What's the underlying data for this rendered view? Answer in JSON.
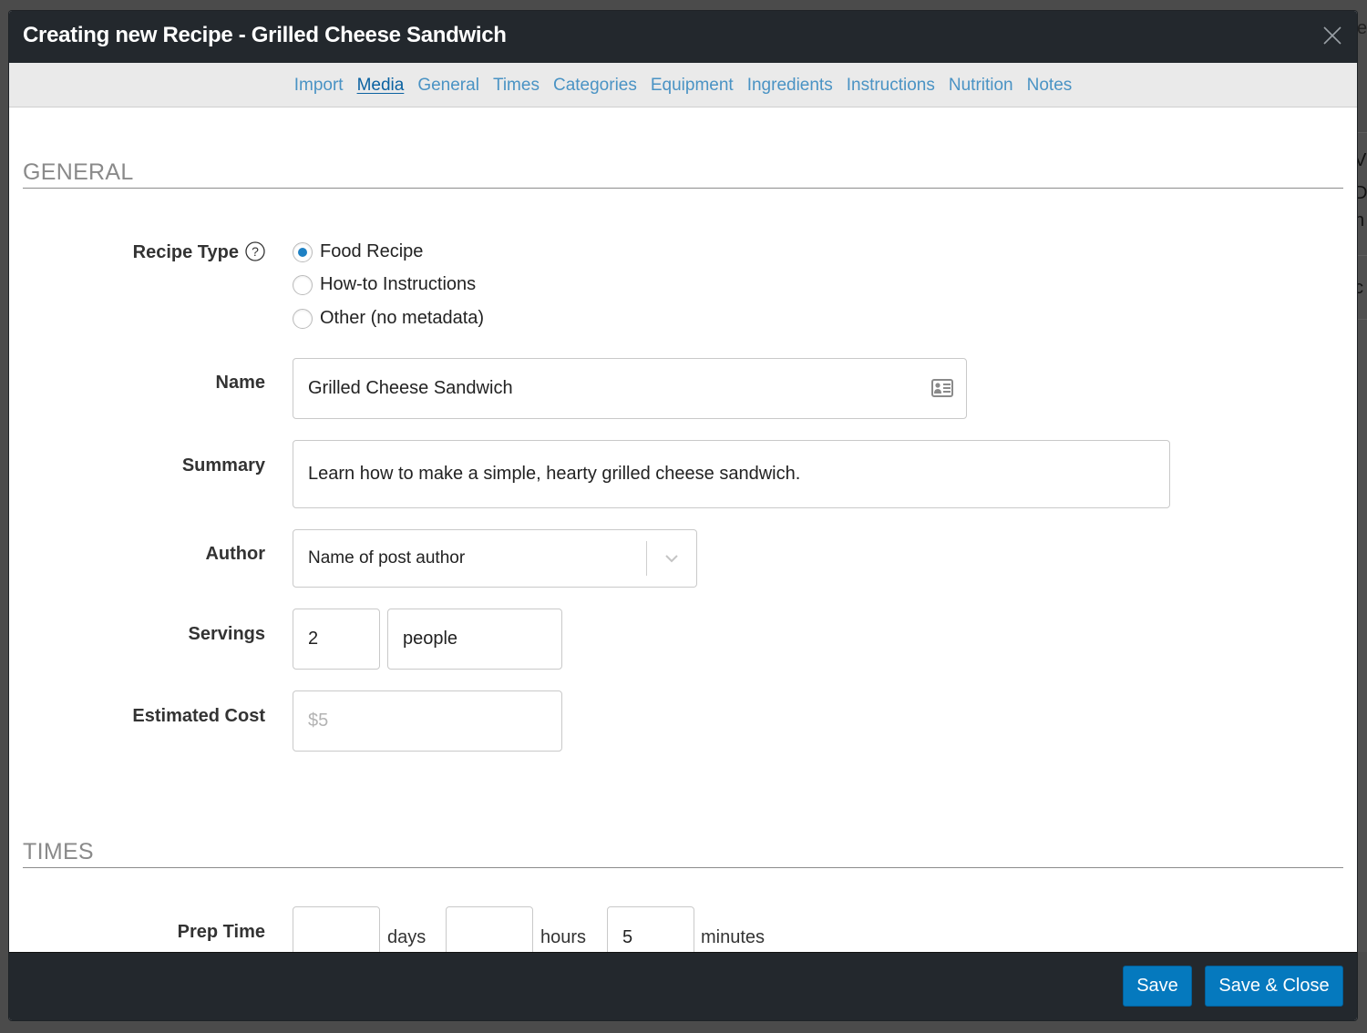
{
  "modal": {
    "title": "Creating new Recipe - Grilled Cheese Sandwich",
    "close_icon": "close-icon"
  },
  "nav": {
    "active": "Media",
    "items": [
      {
        "label": "Import"
      },
      {
        "label": "Media"
      },
      {
        "label": "General"
      },
      {
        "label": "Times"
      },
      {
        "label": "Categories"
      },
      {
        "label": "Equipment"
      },
      {
        "label": "Ingredients"
      },
      {
        "label": "Instructions"
      },
      {
        "label": "Nutrition"
      },
      {
        "label": "Notes"
      }
    ]
  },
  "general": {
    "section_title": "GENERAL",
    "recipe_type": {
      "label": "Recipe Type",
      "help_icon": "question-circle-icon",
      "options": [
        {
          "label": "Food Recipe",
          "checked": true
        },
        {
          "label": "How-to Instructions",
          "checked": false
        },
        {
          "label": "Other (no metadata)",
          "checked": false
        }
      ]
    },
    "name": {
      "label": "Name",
      "value": "Grilled Cheese Sandwich",
      "icon": "contact-card-icon"
    },
    "summary": {
      "label": "Summary",
      "value": "Learn how to make a simple, hearty grilled cheese sandwich."
    },
    "author": {
      "label": "Author",
      "selected": "Name of post author",
      "icon": "chevron-down-icon"
    },
    "servings": {
      "label": "Servings",
      "amount": "2",
      "unit": "people"
    },
    "estimated_cost": {
      "label": "Estimated Cost",
      "value": "",
      "placeholder": "$5"
    }
  },
  "times": {
    "section_title": "TIMES",
    "prep_time": {
      "label": "Prep Time",
      "days": "",
      "days_unit": "days",
      "hours": "",
      "hours_unit": "hours",
      "minutes": "5",
      "minutes_unit": "minutes"
    }
  },
  "footer": {
    "save_label": "Save",
    "save_close_label": "Save & Close"
  },
  "colors": {
    "header_bg": "#23282d",
    "nav_bg": "#eaeaea",
    "link": "#4a93c4",
    "link_active": "#0b62a1",
    "primary_button": "#0579be",
    "radio_checked": "#1e81c4"
  }
}
